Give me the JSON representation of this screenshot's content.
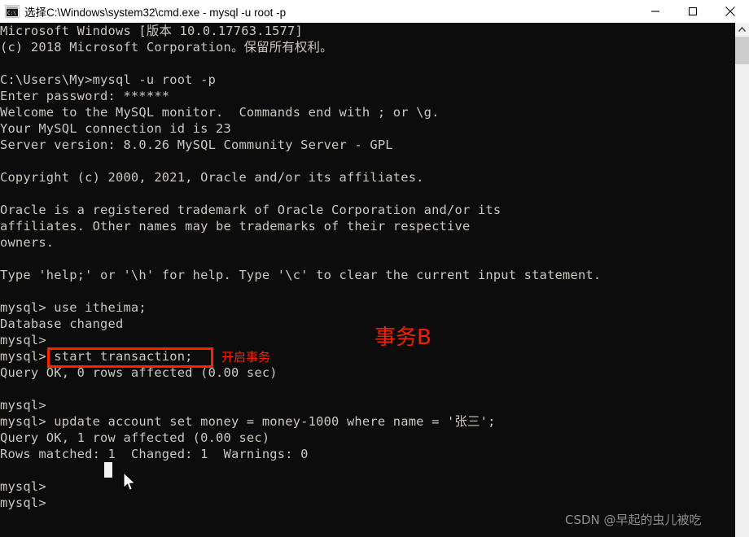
{
  "window": {
    "title": "选择C:\\Windows\\system32\\cmd.exe - mysql  -u root -p",
    "icon_label": "C:\\",
    "minimize_label": "最小化",
    "maximize_label": "最大化",
    "close_label": "关闭",
    "background_color": "#0c0c0c",
    "text_color": "#ccc7bf",
    "titlebar_background": "#ffffff"
  },
  "terminal": {
    "lines": [
      "Microsoft Windows [版本 10.0.17763.1577]",
      "(c) 2018 Microsoft Corporation。保留所有权利。",
      "",
      "C:\\Users\\My>mysql -u root -p",
      "Enter password: ******",
      "Welcome to the MySQL monitor.  Commands end with ; or \\g.",
      "Your MySQL connection id is 23",
      "Server version: 8.0.26 MySQL Community Server - GPL",
      "",
      "Copyright (c) 2000, 2021, Oracle and/or its affiliates.",
      "",
      "Oracle is a registered trademark of Oracle Corporation and/or its",
      "affiliates. Other names may be trademarks of their respective",
      "owners.",
      "",
      "Type 'help;' or '\\h' for help. Type '\\c' to clear the current input statement.",
      "",
      "mysql> use itheima;",
      "Database changed",
      "mysql>",
      "mysql> start transaction;",
      "Query OK, 0 rows affected (0.00 sec)",
      "",
      "mysql>",
      "mysql> update account set money = money-1000 where name = '张三';",
      "Query OK, 1 row affected (0.00 sec)",
      "Rows matched: 1  Changed: 1  Warnings: 0",
      "",
      "mysql>",
      "mysql>"
    ],
    "prompt": "mysql>",
    "database": "itheima",
    "connection_id": "23",
    "server_version": "8.0.26 MySQL Community Server - GPL",
    "windows_version": "10.0.17763.1577",
    "user": "root",
    "host_path": "C:\\Users\\My"
  },
  "annotations": {
    "highlight_command": "start transaction;",
    "highlight_label": "开启事务",
    "transaction_label": "事务B",
    "accent_color": "#ff2200"
  },
  "cursor": {
    "caret_visible": "",
    "pointer_label": ""
  },
  "watermark": {
    "text": "CSDN @早起的虫儿被吃"
  },
  "scrollbar": {
    "up_arrow_label": "向上滚动",
    "thumb_label": "滚动条滑块"
  }
}
